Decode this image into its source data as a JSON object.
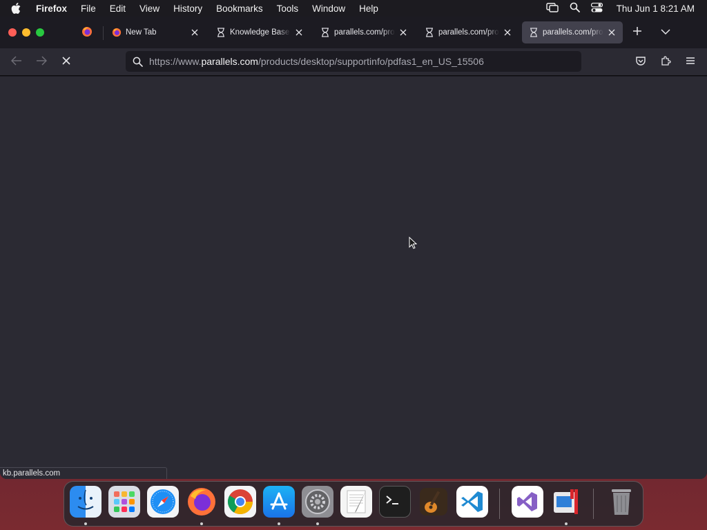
{
  "menubar": {
    "app_name": "Firefox",
    "items": [
      "File",
      "Edit",
      "View",
      "History",
      "Bookmarks",
      "Tools",
      "Window",
      "Help"
    ],
    "clock": "Thu Jun 1  8:21 AM"
  },
  "tabs": [
    {
      "title": "New Tab",
      "icon": "firefox-icon",
      "active": false
    },
    {
      "title": "Knowledge Base",
      "icon": "hourglass-icon",
      "active": false
    },
    {
      "title": "parallels.com/products",
      "icon": "hourglass-icon",
      "active": false
    },
    {
      "title": "parallels.com/products",
      "icon": "hourglass-icon",
      "active": false
    },
    {
      "title": "parallels.com/products",
      "icon": "hourglass-icon",
      "active": true
    }
  ],
  "urlbar": {
    "url_prefix": "https://www.",
    "url_host": "parallels.com",
    "url_path": "/products/desktop/supportinfo/pdfas1_en_US_15506"
  },
  "status": {
    "link_text": "kb.parallels.com"
  },
  "dock": {
    "apps": [
      "Finder",
      "Launchpad",
      "Safari",
      "Firefox",
      "Chrome",
      "App Store",
      "System Preferences",
      "TextEdit",
      "Terminal",
      "GarageBand",
      "Visual Studio Code",
      "Visual Studio",
      "Parallels Desktop",
      "Trash"
    ]
  },
  "colors": {
    "menubar_bg": "#1c1b20",
    "tabstrip_bg": "#1c1b22",
    "toolbar_bg": "#2b2a33",
    "active_tab_bg": "#42414d",
    "page_bg": "#2b2a33"
  }
}
